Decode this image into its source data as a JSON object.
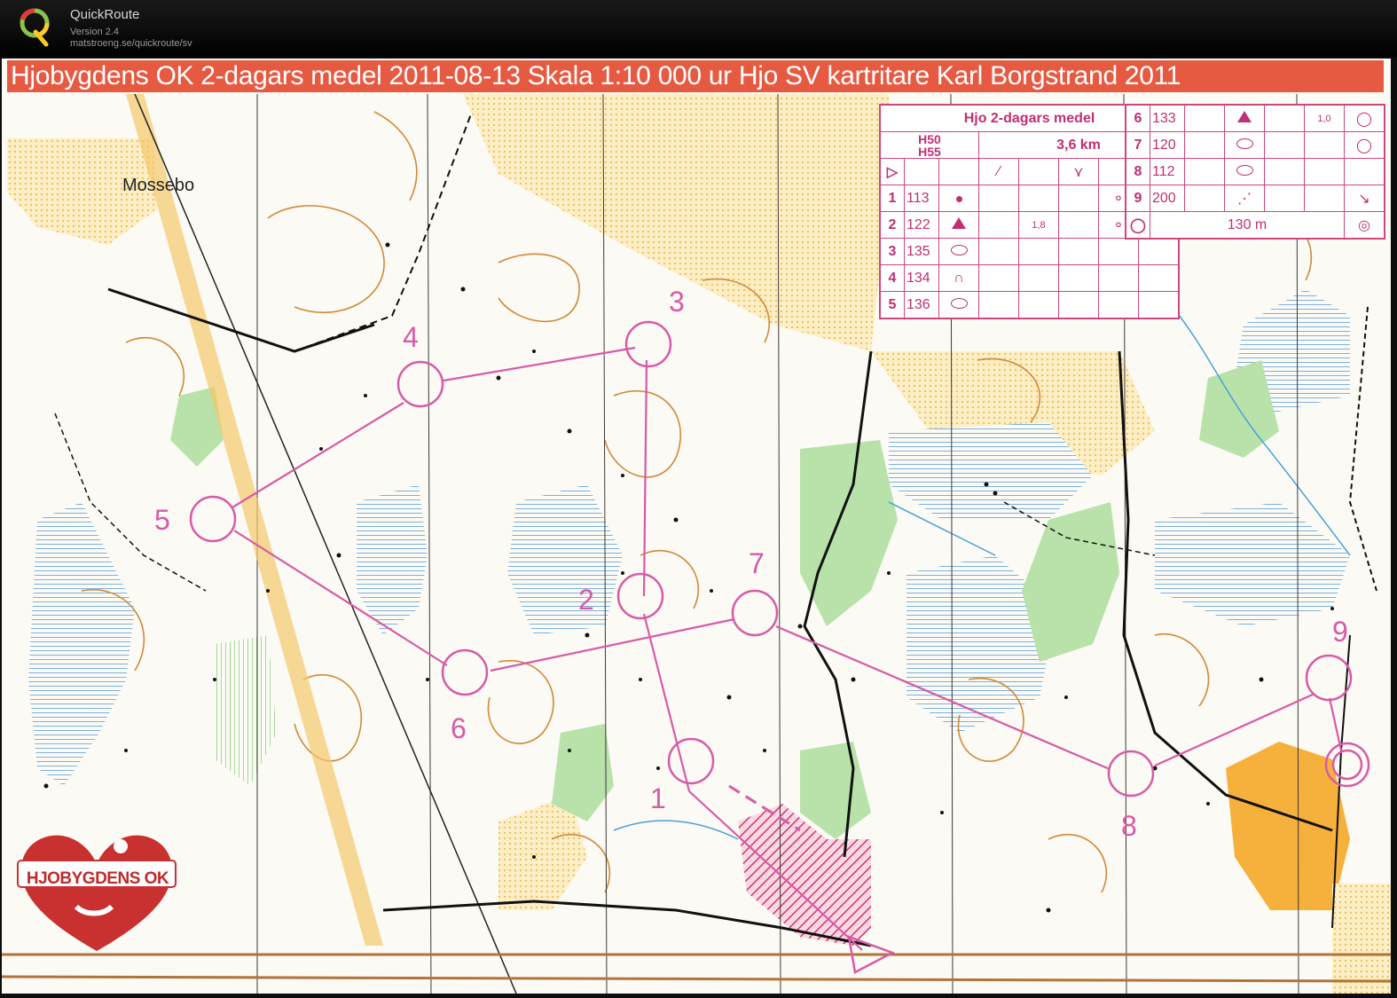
{
  "app": {
    "title": "QuickRoute",
    "version": "Version 2.4",
    "url": "matstroeng.se/quickroute/sv",
    "logo_icon": "quickroute-q-logo"
  },
  "map": {
    "banner": "Hjobygdens OK 2-dagars medel 2011-08-13 Skala 1:10 000 ur Hjo SV  kartritare Karl Borgstrand 2011",
    "place_name": "Mossebo",
    "club_logo_text": "HJOBYGDENS OK",
    "course_color": "#d75ba7",
    "banner_color": "#e65a42"
  },
  "description_sheet": {
    "title": "Hjo 2-dagars medel",
    "classes": "H50\nH55",
    "length": "3,6 km",
    "controls_left": [
      {
        "num": "1",
        "code": "113",
        "symbol": "dot",
        "note": "",
        "extra": "hill-icon"
      },
      {
        "num": "2",
        "code": "122",
        "symbol": "triangle",
        "note": "1,8",
        "extra": "hill-icon"
      },
      {
        "num": "3",
        "code": "135",
        "symbol": "oval",
        "note": "",
        "extra": ""
      },
      {
        "num": "4",
        "code": "134",
        "symbol": "knoll",
        "note": "",
        "extra": ""
      },
      {
        "num": "5",
        "code": "136",
        "symbol": "oval",
        "note": "",
        "extra": ""
      }
    ],
    "controls_right": [
      {
        "num": "6",
        "code": "133",
        "symbol": "triangle",
        "note": "1,0",
        "extra": "side-icon"
      },
      {
        "num": "7",
        "code": "120",
        "symbol": "oval",
        "note": "",
        "extra": "side-icon"
      },
      {
        "num": "8",
        "code": "112",
        "symbol": "oval",
        "note": "",
        "extra": ""
      },
      {
        "num": "9",
        "code": "200",
        "symbol": "dashed-line",
        "note": "",
        "extra": "corner-icon"
      }
    ],
    "finish_distance": "130 m"
  },
  "controls": [
    "1",
    "2",
    "3",
    "4",
    "5",
    "6",
    "7",
    "8",
    "9"
  ]
}
